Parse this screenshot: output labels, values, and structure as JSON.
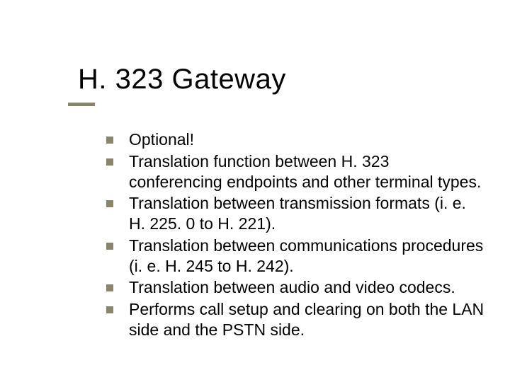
{
  "slide": {
    "title": "H. 323 Gateway",
    "bullets": [
      "Optional!",
      "Translation function between H. 323 conferencing endpoints and other terminal types.",
      "Translation between transmission formats (i. e. H. 225. 0 to H. 221).",
      "Translation between communications procedures (i. e. H. 245 to H. 242).",
      "Translation between audio and video codecs.",
      "Performs call setup and clearing on both the LAN side and the PSTN side."
    ]
  }
}
